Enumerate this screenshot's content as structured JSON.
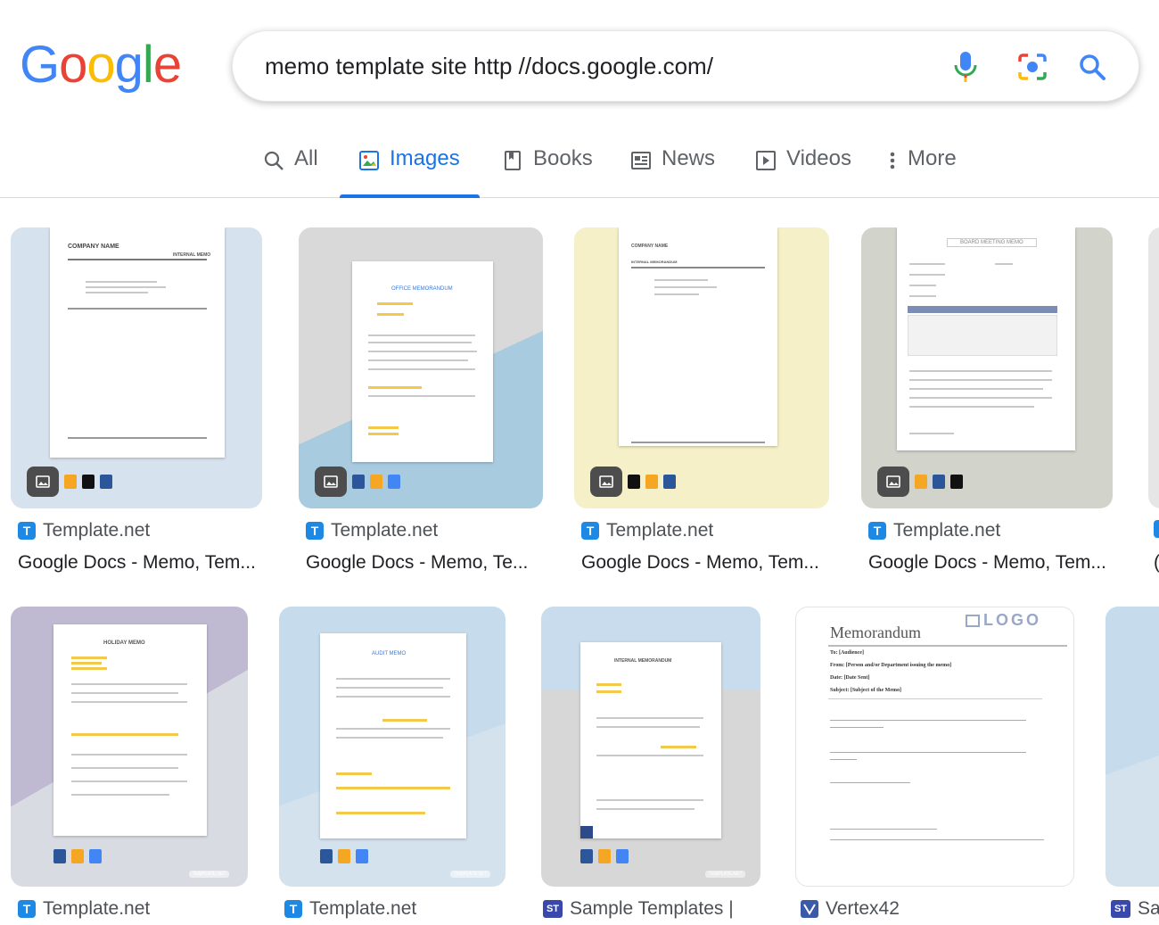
{
  "logo": {
    "letters": [
      "G",
      "o",
      "o",
      "g",
      "l",
      "e"
    ],
    "colors": [
      "#4285f4",
      "#ea4335",
      "#fbbc05",
      "#4285f4",
      "#34a853",
      "#ea4335"
    ]
  },
  "search": {
    "query": "memo template site http //docs.google.com/"
  },
  "tabs": [
    {
      "label": "All",
      "icon": "search-icon"
    },
    {
      "label": "Images",
      "icon": "image-icon",
      "active": true
    },
    {
      "label": "Books",
      "icon": "book-icon"
    },
    {
      "label": "News",
      "icon": "news-icon"
    },
    {
      "label": "Videos",
      "icon": "video-icon"
    },
    {
      "label": "More",
      "icon": "more-vert-icon"
    }
  ],
  "results": [
    {
      "source": "Template.net",
      "title": "Google Docs - Memo, Tem...",
      "doc_heading": "COMPANY NAME",
      "doc_subheading": "INTERNAL MEMO",
      "formats": [
        "pages-icon",
        "pdf-icon",
        "word-icon"
      ]
    },
    {
      "source": "Template.net",
      "title": "Google Docs - Memo, Te...",
      "doc_heading": "OFFICE MEMORANDUM",
      "formats": [
        "word-icon",
        "pages-icon",
        "docs-icon"
      ]
    },
    {
      "source": "Template.net",
      "title": "Google Docs - Memo, Tem...",
      "doc_heading": "COMPANY NAME",
      "doc_subheading": "INTERNAL MEMORANDUM",
      "formats": [
        "pdf-icon",
        "pages-icon",
        "word-icon"
      ]
    },
    {
      "source": "Template.net",
      "title": "Google Docs - Memo, Tem...",
      "doc_heading": "BOARD MEETING MEMO",
      "formats": [
        "pages-icon",
        "word-icon",
        "pdf-icon"
      ]
    },
    {
      "source": "Template.net",
      "doc_heading": "HOLIDAY MEMO",
      "formats": [
        "word-icon",
        "pages-icon",
        "docs-icon"
      ],
      "watermark": "TEMPLATE.NET"
    },
    {
      "source": "Template.net",
      "doc_heading": "AUDIT MEMO",
      "formats": [
        "word-icon",
        "pages-icon",
        "docs-icon"
      ],
      "watermark": "TEMPLATE.NET"
    },
    {
      "source": "Sample Templates |",
      "doc_heading": "INTERNAL MEMORANDUM",
      "formats": [
        "word-icon",
        "pages-icon",
        "docs-icon"
      ],
      "watermark": "TEMPLATE.NET"
    },
    {
      "source": "Vertex42",
      "doc_heading": "Memorandum",
      "logo_text": "LOGO",
      "memo_lines": [
        "To: [Audience]",
        "From: [Person and/or Department issuing the memo]",
        "Date: [Date Sent]",
        "Subject: [Subject of the Memo]"
      ]
    },
    {
      "source": "Sa"
    }
  ],
  "partial_card_title": "(",
  "colors": {
    "accent": "#1a73e8",
    "tab_inactive": "#5f6368"
  }
}
